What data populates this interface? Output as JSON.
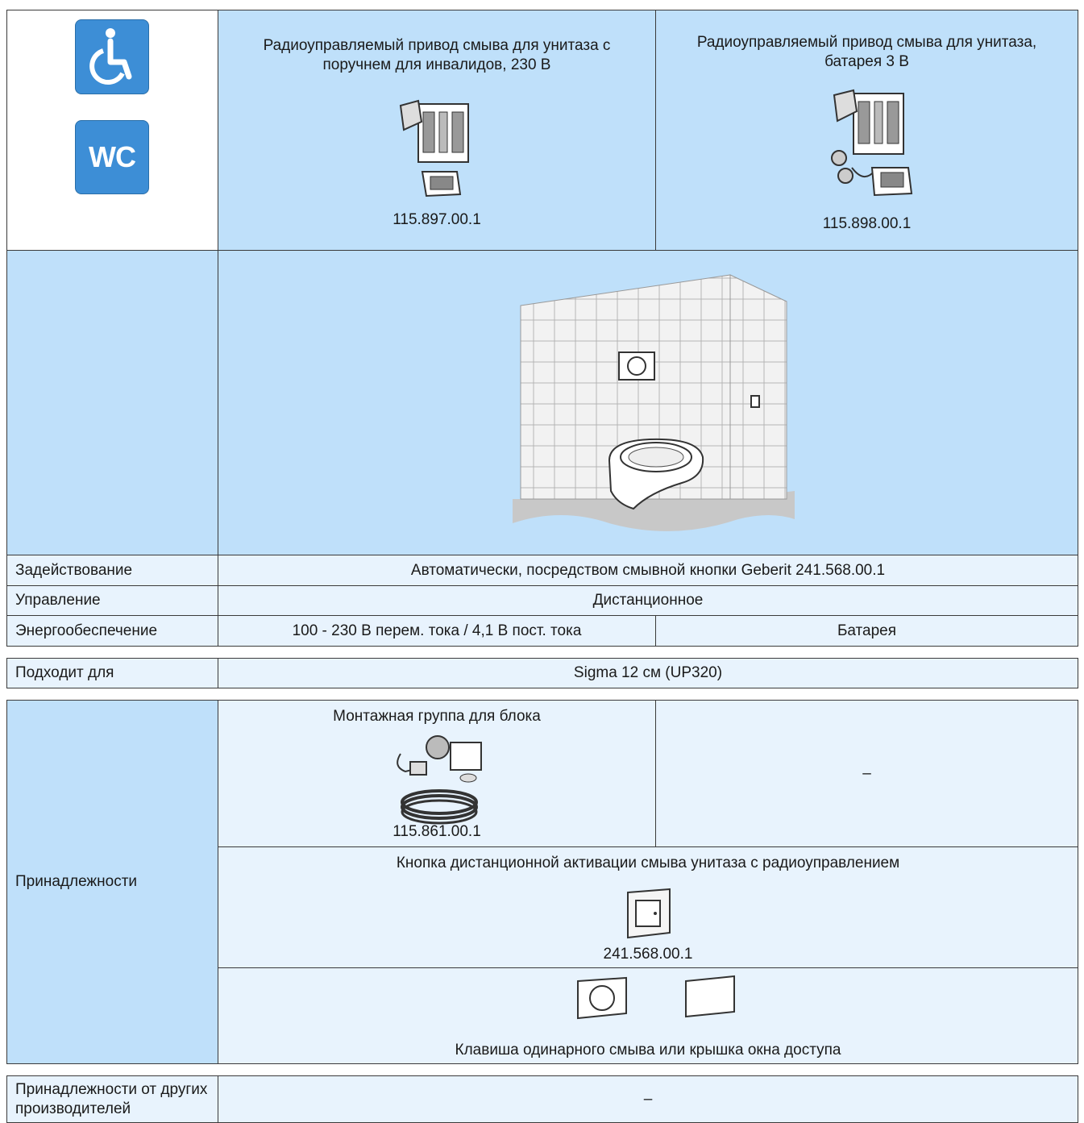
{
  "header": {
    "icons": [
      "wheelchair-icon",
      "wc-icon"
    ],
    "wc_text": "WC",
    "col1_title": "Радиоуправляемый привод смыва для унитаза с поручнем для инвалидов, 230 В",
    "col1_code": "115.897.00.1",
    "col2_title": "Радиоуправляемый привод смыва для унитаза, батарея 3 В",
    "col2_code": "115.898.00.1"
  },
  "rows": {
    "activation_label": "Задействование",
    "activation_value": "Автоматически, посредством смывной кнопки Geberit 241.568.00.1",
    "control_label": "Управление",
    "control_value": "Дистанционное",
    "power_label": "Энергообеспечение",
    "power_value_1": "100 - 230 В перем. тока / 4,1 В пост. тока",
    "power_value_2": "Батарея",
    "suitable_label": "Подходит для",
    "suitable_value": "Sigma 12 см (UP320)",
    "accessories_label": "Принадлежности",
    "acc1_title": "Монтажная группа для блока",
    "acc1_code": "115.861.00.1",
    "acc1_col2": "–",
    "acc2_title": "Кнопка дистанционной активации смыва унитаза с радиоуправлением",
    "acc2_code": "241.568.00.1",
    "acc3_title": "Клавиша одинарного смыва или крышка окна доступа",
    "third_party_label": "Принадлежности от других производителей",
    "third_party_value": "–"
  },
  "colors": {
    "header_blue": "#bfe0fa",
    "row_light": "#e8f3fd",
    "icon_blue": "#3d8ed6"
  }
}
